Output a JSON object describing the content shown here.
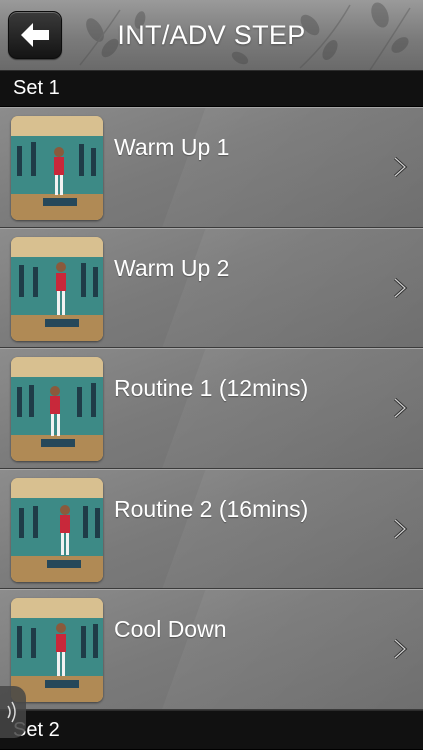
{
  "header": {
    "title": "INT/ADV STEP",
    "back_icon": "arrow-left-icon"
  },
  "sections": [
    {
      "label": "Set 1",
      "items": [
        {
          "label": "Warm Up 1",
          "thumbnail": "step-class-video-thumbnail"
        },
        {
          "label": "Warm Up 2",
          "thumbnail": "step-class-video-thumbnail"
        },
        {
          "label": "Routine 1 (12mins)",
          "thumbnail": "step-class-video-thumbnail"
        },
        {
          "label": "Routine 2 (16mins)",
          "thumbnail": "step-class-video-thumbnail"
        },
        {
          "label": "Cool Down",
          "thumbnail": "step-class-video-thumbnail"
        }
      ]
    },
    {
      "label": "Set 2",
      "items": []
    }
  ],
  "icons": {
    "row_accessory": "chevron-right-icon",
    "audio_toggle": "speaker-icon"
  },
  "colors": {
    "header_bg": "#7b7b7b",
    "section_bg": "#111111",
    "row_bg": "#7a7a7a",
    "text": "#ffffff"
  }
}
